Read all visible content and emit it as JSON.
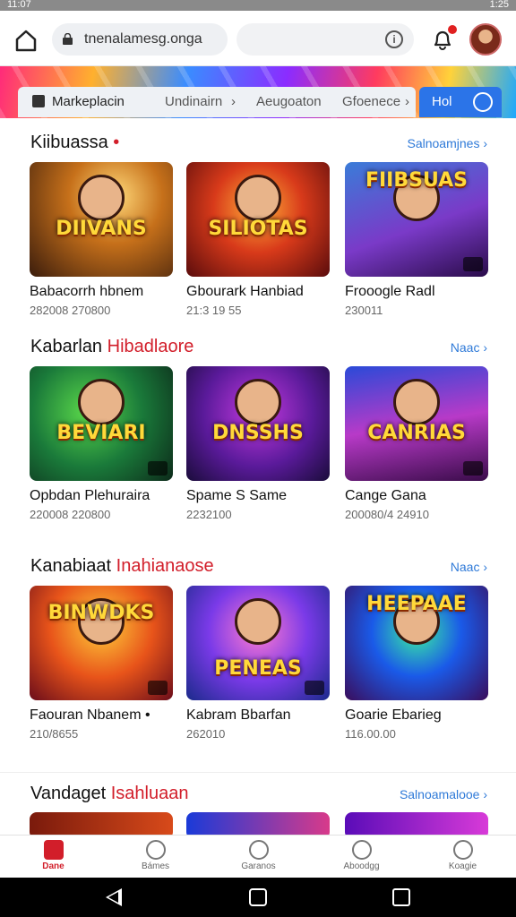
{
  "status_bar": {
    "time": "11:07",
    "right_time": "1:25"
  },
  "address_bar": {
    "url": "tnenalamesg.onga"
  },
  "breadcrumb": {
    "items": [
      "Markeplacin",
      "Undinairn",
      "Aeugoaton",
      "Gfoenece"
    ],
    "action_label": "Hol"
  },
  "sections": [
    {
      "title": "Kiibuassa",
      "title_accent": "•",
      "more": "Salnoamjnes ›",
      "cards": [
        {
          "logo": "DIIVANS",
          "name": "Babacorrh hbnem",
          "meta": "282008 270800",
          "icon": "game-art-icon"
        },
        {
          "logo": "SILIOTAS",
          "name": "Gbourark Hanbiad",
          "meta": "21:3 19 55",
          "icon": "game-art-icon"
        },
        {
          "logo": "FIIBSUAS",
          "name": "Frooogle Radl",
          "meta": "230011",
          "icon": "game-art-icon"
        }
      ]
    },
    {
      "title": "Kabarlan",
      "title_accent": "Hibadlaore",
      "more": "Naac ›",
      "cards": [
        {
          "logo": "BEVIARI",
          "name": "Opbdan Plehuraira",
          "meta": "220008 220800",
          "icon": "game-art-icon"
        },
        {
          "logo": "DNSSHS",
          "name": "Spame S Same",
          "meta": "2232100",
          "icon": "game-art-icon"
        },
        {
          "logo": "CANRIAS",
          "name": "Cange Gana",
          "meta": "200080/4 24910",
          "icon": "game-art-icon"
        }
      ]
    },
    {
      "title": "Kanabiaat",
      "title_accent": "Inahianaose",
      "more": "Naac ›",
      "cards": [
        {
          "logo": "BINWDKS",
          "name": "Faouran Nbanem •",
          "meta": "210/8655",
          "icon": "game-art-icon"
        },
        {
          "logo": "PENEAS",
          "name": "Kabram Bbarfan",
          "meta": "262010",
          "icon": "game-art-icon"
        },
        {
          "logo": "HEEPAAE",
          "name": "Goarie Ebarieg",
          "meta": "116.00.00",
          "icon": "game-art-icon"
        }
      ]
    },
    {
      "title": "Vandaget",
      "title_accent": "Isahluaan",
      "more": "Salnoamalooe ›",
      "cards": []
    }
  ],
  "bottom_nav": [
    {
      "label": "Dane",
      "icon": "home-icon",
      "active": true
    },
    {
      "label": "Bámes",
      "icon": "smile-icon",
      "active": false
    },
    {
      "label": "Garanos",
      "icon": "profile-icon",
      "active": false
    },
    {
      "label": "Aboodgg",
      "icon": "heart-icon",
      "active": false
    },
    {
      "label": "Koagie",
      "icon": "user-icon",
      "active": false
    }
  ]
}
